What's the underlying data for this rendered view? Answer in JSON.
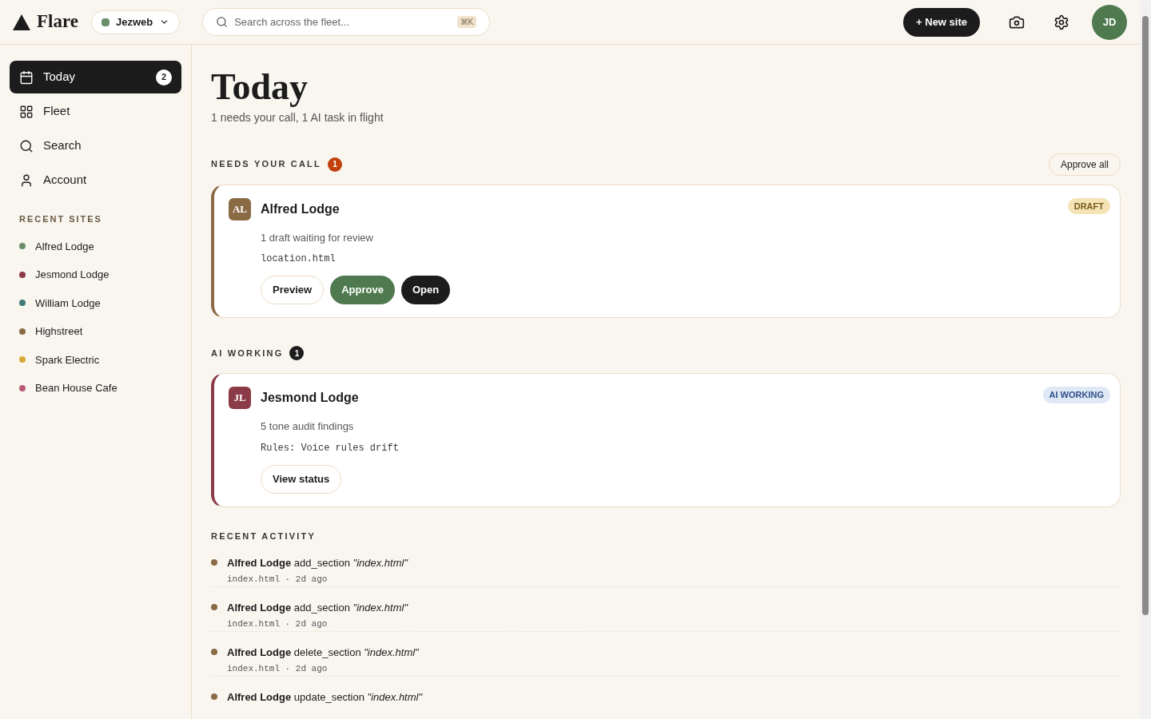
{
  "brand": {
    "name": "Flare"
  },
  "workspace": {
    "name": "Jezweb",
    "color": "#6b8f6b"
  },
  "search": {
    "placeholder": "Search across the fleet...",
    "shortcut": "⌘K"
  },
  "header_actions": {
    "new_site": "+ New site",
    "avatar": "JD"
  },
  "nav": [
    {
      "label": "Today",
      "kind": "calendar",
      "selected": true,
      "badge": "2"
    },
    {
      "label": "Fleet",
      "kind": "grid",
      "selected": false
    },
    {
      "label": "Search",
      "kind": "search",
      "selected": false
    },
    {
      "label": "Account",
      "kind": "user",
      "selected": false
    }
  ],
  "recent_sites": {
    "title": "RECENT SITES",
    "items": [
      {
        "name": "Alfred Lodge",
        "color": "#6b8f6b"
      },
      {
        "name": "Jesmond Lodge",
        "color": "#8b3a48"
      },
      {
        "name": "William Lodge",
        "color": "#3f7a74"
      },
      {
        "name": "Highstreet",
        "color": "#8b6b45"
      },
      {
        "name": "Spark Electric",
        "color": "#d9a838"
      },
      {
        "name": "Bean House Cafe",
        "color": "#b85a78"
      }
    ]
  },
  "page": {
    "title": "Today",
    "subtitle": "1 needs your call, 1 AI task in flight"
  },
  "sections": [
    {
      "title": "NEEDS YOUR CALL",
      "count": "1",
      "kind": "alert",
      "action": "Approve all",
      "cards": [
        {
          "initials": "AL",
          "name": "Alfred Lodge",
          "color": "#8b6b45",
          "status": "DRAFT",
          "kind": "draft",
          "summary": "1 draft waiting for review",
          "detail": "location.html",
          "buttons": [
            {
              "label": "Preview",
              "kind": "outline"
            },
            {
              "label": "Approve",
              "kind": "primary"
            },
            {
              "label": "Open",
              "kind": "dark"
            }
          ]
        }
      ]
    },
    {
      "title": "AI WORKING",
      "count": "1",
      "kind": "neutral",
      "cards": [
        {
          "initials": "JL",
          "name": "Jesmond Lodge",
          "color": "#8b3a48",
          "status": "AI WORKING",
          "kind": "working",
          "summary": "5 tone audit findings",
          "detail": "Rules: Voice rules drift",
          "buttons": [
            {
              "label": "View status",
              "kind": "outline"
            }
          ]
        }
      ]
    }
  ],
  "activity": {
    "title": "RECENT ACTIVITY",
    "items": [
      {
        "text": "**Alfred Lodge** add_section *\"index.html\"*",
        "meta": "index.html · 2d ago"
      },
      {
        "text": "**Alfred Lodge** add_section *\"index.html\"*",
        "meta": "index.html · 2d ago"
      },
      {
        "text": "**Alfred Lodge** delete_section *\"index.html\"*",
        "meta": "index.html · 2d ago"
      },
      {
        "text": "**Alfred Lodge** update_section *\"index.html\"*"
      }
    ]
  }
}
